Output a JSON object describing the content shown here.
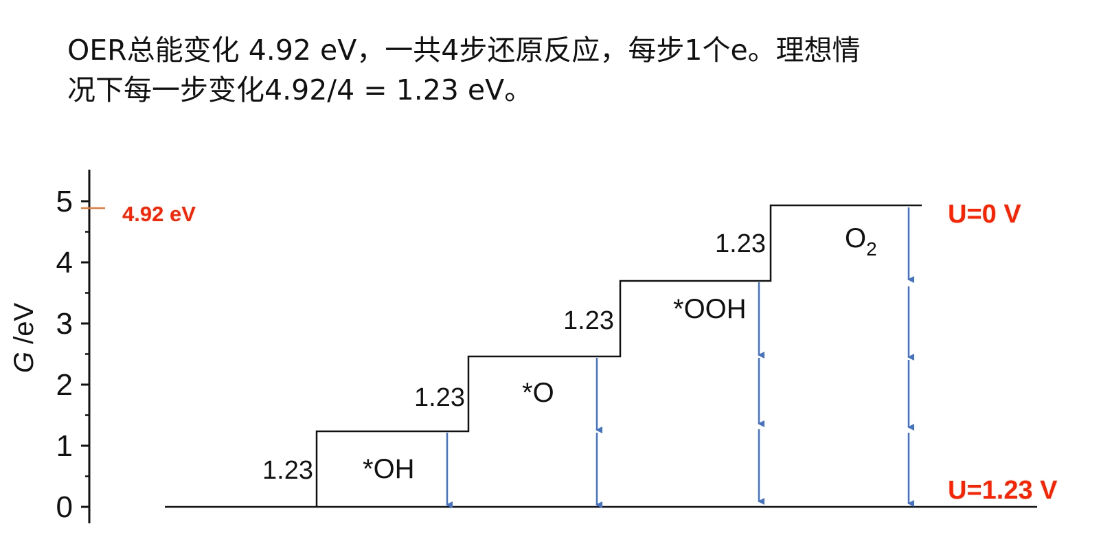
{
  "intro": {
    "line1": "OER总能变化 4.92 eV，一共4步还原反应，每步1个e。理想情",
    "line2": "况下每一步变化4.92/4 = 1.23 eV。"
  },
  "axis": {
    "title_var": "G",
    "title_unit": " /eV",
    "ticks": [
      "0",
      "1",
      "2",
      "3",
      "4",
      "5"
    ]
  },
  "marker_label": "4.92 eV",
  "potential_top": "U=0 V",
  "potential_bottom": "U=1.23 V",
  "steps": [
    {
      "label": "1.23",
      "species": "*OH"
    },
    {
      "label": "1.23",
      "species": "*O"
    },
    {
      "label": "1.23",
      "species": "*OOH"
    },
    {
      "label": "1.23",
      "species": "O",
      "species_sub": "2"
    }
  ],
  "colors": {
    "axis": "#111111",
    "steps": "#111111",
    "arrows": "#4472c4",
    "potential": "#ff2200",
    "marker_tick": "#e07b39"
  },
  "chart_data": {
    "type": "step",
    "y_axis": {
      "label": "G /eV",
      "range": [
        0,
        5
      ],
      "ticks": [
        0,
        1,
        2,
        3,
        4,
        5
      ]
    },
    "levels": [
      0,
      1.23,
      2.46,
      3.69,
      4.92
    ],
    "step_labels": [
      "1.23",
      "1.23",
      "1.23",
      "1.23"
    ],
    "species": [
      "*OH",
      "*O",
      "*OOH",
      "O2"
    ],
    "annotations": [
      "4.92 eV",
      "U=0 V",
      "U=1.23 V"
    ]
  }
}
